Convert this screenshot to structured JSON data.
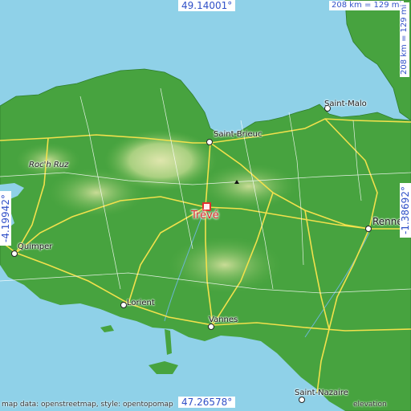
{
  "map": {
    "marker": {
      "name": "Trévé",
      "icon": "location-square-icon"
    },
    "cities": [
      {
        "key": "saint-malo",
        "name": "Saint-Malo",
        "icon": "city-dot-icon"
      },
      {
        "key": "saint-brieuc",
        "name": "Saint-Brieuc",
        "icon": "city-dot-icon"
      },
      {
        "key": "rennes",
        "name": "Rennes",
        "icon": "city-dot-icon"
      },
      {
        "key": "quimper",
        "name": "Quimper",
        "icon": "city-dot-icon"
      },
      {
        "key": "lorient",
        "name": "Lorient",
        "icon": "city-dot-icon"
      },
      {
        "key": "vannes",
        "name": "Vannes",
        "icon": "city-dot-icon"
      },
      {
        "key": "saint-nazaire",
        "name": "Saint-Nazaire",
        "icon": "city-dot-icon"
      }
    ],
    "places": [
      {
        "key": "roc-h-ruz",
        "name": "Roc'h Ruz"
      }
    ],
    "coordinates": {
      "top": "49.14001°",
      "bottom": "47.26578°",
      "left": "-4.19942°",
      "right": "-1.38692°"
    },
    "scale": {
      "horizontal": "208 km = 129 mi",
      "vertical": "208 km = 129 mi"
    },
    "attribution": {
      "left": "map data: openstreetmap, style: opentopomap",
      "right": "elevation"
    },
    "colors": {
      "sea": "#8fd1e8",
      "low": "#3f9f3a",
      "mid": "#8cc56a",
      "high": "#d9e3a6",
      "road": "#f2e14c",
      "marker": "#e03030",
      "coord_text": "#3050c8"
    }
  }
}
